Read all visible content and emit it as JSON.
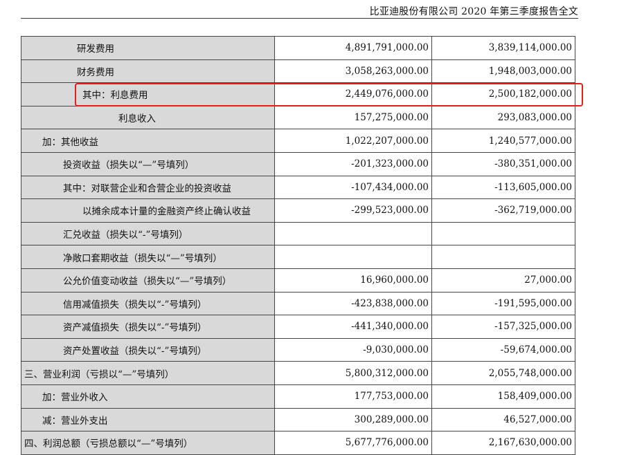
{
  "header": {
    "title": "比亚迪股份有限公司 2020 年第三季度报告全文"
  },
  "table": {
    "rows": [
      {
        "label": "研发费用",
        "indent": 3,
        "current": "4,891,791,000.00",
        "prior": "3,839,114,000.00"
      },
      {
        "label": "财务费用",
        "indent": 3,
        "current": "3,058,263,000.00",
        "prior": "1,948,003,000.00"
      },
      {
        "label": "其中：利息费用",
        "indent": 4,
        "current": "2,449,076,000.00",
        "prior": "2,500,182,000.00",
        "highlight": true
      },
      {
        "label": "利息收入",
        "indent": 5,
        "current": "157,275,000.00",
        "prior": "293,083,000.00"
      },
      {
        "label": "加：其他收益",
        "indent": 1,
        "current": "1,022,207,000.00",
        "prior": "1,240,577,000.00"
      },
      {
        "label": "投资收益（损失以“—”号填列）",
        "indent": 2,
        "current": "-201,323,000.00",
        "prior": "-380,351,000.00"
      },
      {
        "label": "其中：对联营企业和合营企业的投资收益",
        "indent": 2,
        "current": "-107,434,000.00",
        "prior": "-113,605,000.00"
      },
      {
        "label": "以摊余成本计量的金融资产终止确认收益",
        "indent": 4,
        "current": "-299,523,000.00",
        "prior": "-362,719,000.00"
      },
      {
        "label": "汇兑收益（损失以“-”号填列）",
        "indent": 2,
        "current": "",
        "prior": ""
      },
      {
        "label": "净敞口套期收益（损失以“—”号填列）",
        "indent": 2,
        "current": "",
        "prior": ""
      },
      {
        "label": "公允价值变动收益（损失以“—”号填列）",
        "indent": 2,
        "current": "16,960,000.00",
        "prior": "27,000.00"
      },
      {
        "label": "信用减值损失（损失以“-”号填列）",
        "indent": 2,
        "current": "-423,838,000.00",
        "prior": "-191,595,000.00"
      },
      {
        "label": "资产减值损失（损失以“-”号填列）",
        "indent": 2,
        "current": "-441,340,000.00",
        "prior": "-157,325,000.00"
      },
      {
        "label": "资产处置收益（损失以“-”号填列）",
        "indent": 2,
        "current": "-9,030,000.00",
        "prior": "-59,674,000.00"
      },
      {
        "label": "三、营业利润（亏损以“—”号填列）",
        "indent": 0,
        "current": "5,800,312,000.00",
        "prior": "2,055,748,000.00"
      },
      {
        "label": "加：营业外收入",
        "indent": 1,
        "current": "177,753,000.00",
        "prior": "158,409,000.00"
      },
      {
        "label": "减：营业外支出",
        "indent": 1,
        "current": "300,289,000.00",
        "prior": "46,527,000.00"
      },
      {
        "label": "四、利润总额（亏损总额以“—”号填列）",
        "indent": 0,
        "current": "5,677,776,000.00",
        "prior": "2,167,630,000.00"
      }
    ]
  },
  "colors": {
    "label_bg": "#d9d9d9",
    "highlight": "#e02020",
    "border": "#444444"
  }
}
